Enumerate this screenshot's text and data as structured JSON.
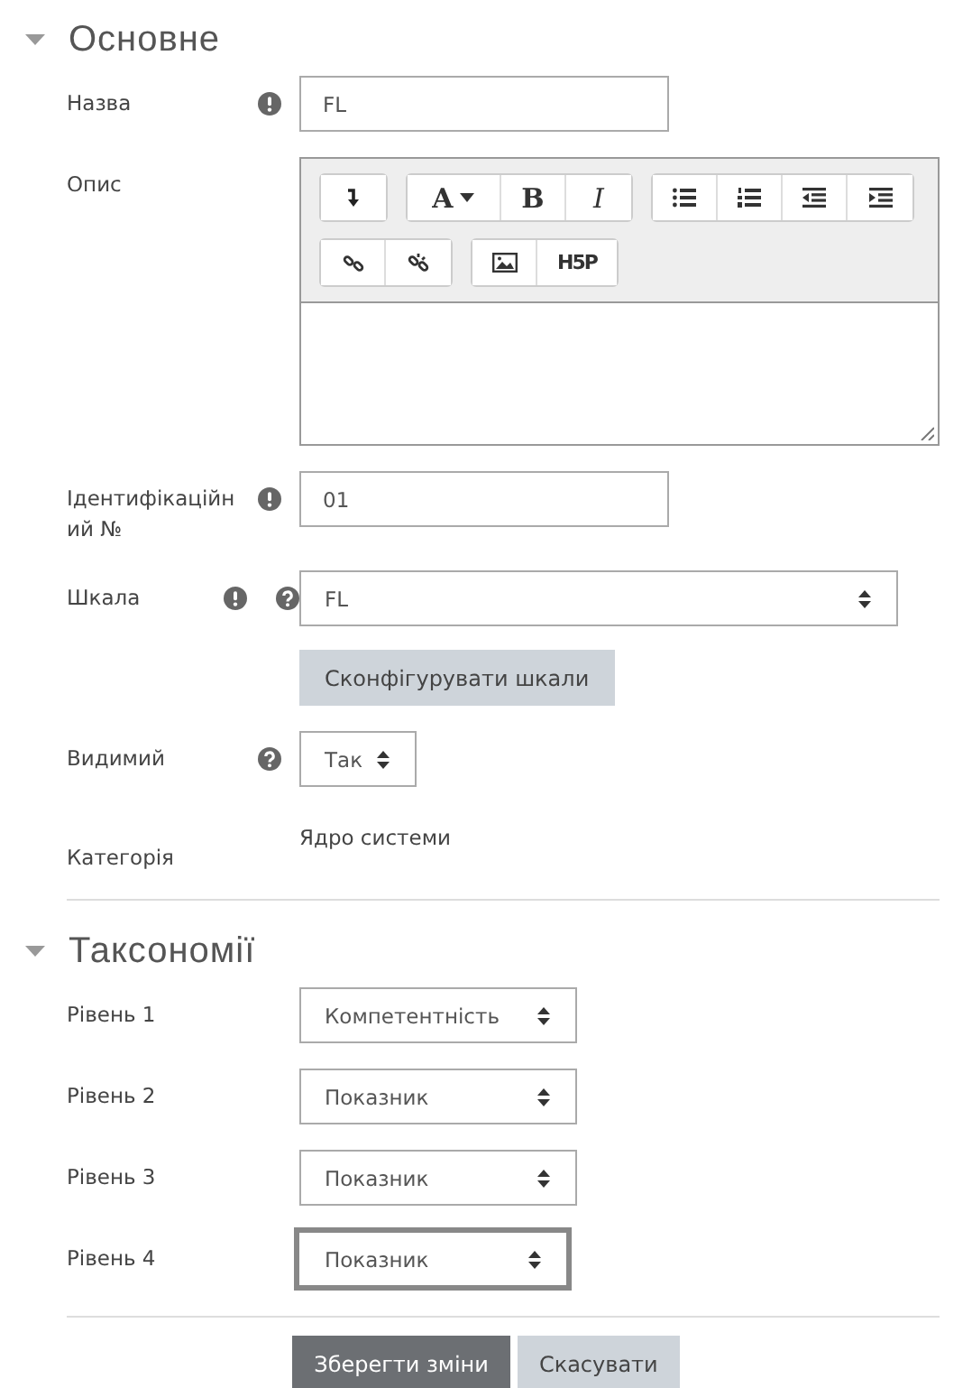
{
  "sections": [
    {
      "title": "Основне",
      "expanded": true,
      "fields": [
        {
          "kind": "text",
          "label": "Назва",
          "required": true,
          "help": false,
          "value": "FL"
        },
        {
          "kind": "editor",
          "label": "Опис",
          "required": false,
          "help": false,
          "toolbar": [
            [
              [
                {
                  "kind": "arrow"
                }
              ],
              [
                {
                  "kind": "font",
                  "label": "A"
                },
                {
                  "kind": "bold",
                  "label": "B"
                },
                {
                  "kind": "italic",
                  "label": "I"
                }
              ],
              [
                {
                  "kind": "bullets"
                },
                {
                  "kind": "numbers"
                },
                {
                  "kind": "outdent"
                },
                {
                  "kind": "indent"
                }
              ]
            ],
            [
              [
                {
                  "kind": "link"
                },
                {
                  "kind": "unlink"
                }
              ],
              [
                {
                  "kind": "image"
                },
                {
                  "kind": "logo",
                  "label": "H5P"
                }
              ]
            ]
          ]
        },
        {
          "kind": "text",
          "label": "Ідентифікаційний №",
          "required": true,
          "help": false,
          "value": "01"
        },
        {
          "kind": "wide-select",
          "label": "Шкала",
          "required": true,
          "help": true,
          "value": "FL",
          "focused": false
        },
        {
          "kind": "button",
          "label": "Сконфігурувати шкали"
        },
        {
          "kind": "select",
          "label": "Видимий",
          "required": false,
          "help": true,
          "value": "Так",
          "focused": false
        },
        {
          "kind": "static",
          "label": "Категорія",
          "value": "Ядро системи"
        }
      ]
    },
    {
      "title": "Таксономії",
      "kind": "levels",
      "expanded": true,
      "fields": [
        {
          "kind": "select",
          "label": "Рівень 1",
          "required": false,
          "help": false,
          "value": "Компетентність",
          "focused": false
        },
        {
          "kind": "select",
          "label": "Рівень 2",
          "required": false,
          "help": false,
          "value": "Показник",
          "focused": false
        },
        {
          "kind": "select",
          "label": "Рівень 3",
          "required": false,
          "help": false,
          "value": "Показник",
          "focused": false
        },
        {
          "kind": "select",
          "label": "Рівень 4",
          "required": false,
          "help": false,
          "value": "Показник",
          "focused": true
        }
      ]
    }
  ],
  "buttons": [
    {
      "label": "Зберегти зміни",
      "primary": true
    },
    {
      "label": "Скасувати",
      "primary": false
    }
  ]
}
